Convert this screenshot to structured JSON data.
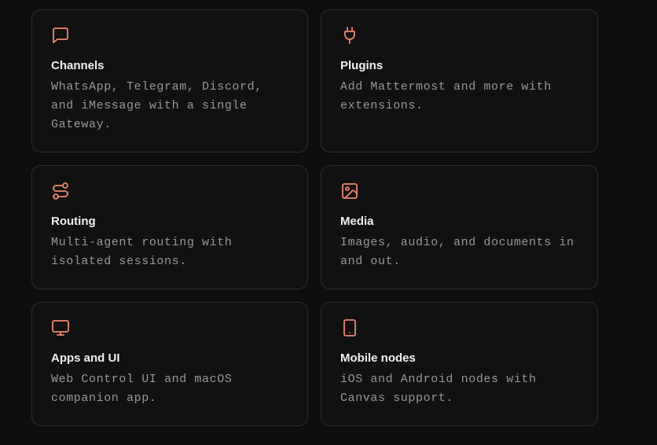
{
  "features": [
    {
      "icon": "message-square-icon",
      "title": "Channels",
      "description": "WhatsApp, Telegram, Discord, and iMessage with a single Gateway."
    },
    {
      "icon": "plug-icon",
      "title": "Plugins",
      "description": "Add Mattermost and more with extensions."
    },
    {
      "icon": "route-icon",
      "title": "Routing",
      "description": "Multi-agent routing with isolated sessions."
    },
    {
      "icon": "image-icon",
      "title": "Media",
      "description": "Images, audio, and documents in and out."
    },
    {
      "icon": "monitor-icon",
      "title": "Apps and UI",
      "description": "Web Control UI and macOS companion app."
    },
    {
      "icon": "smartphone-icon",
      "title": "Mobile nodes",
      "description": "iOS and Android nodes with Canvas support."
    }
  ],
  "colors": {
    "accent": "#f0866a",
    "background": "#0f0e0e",
    "card_border": "#2e2c2b",
    "title": "#f2f0ee",
    "description": "#9a9693"
  }
}
